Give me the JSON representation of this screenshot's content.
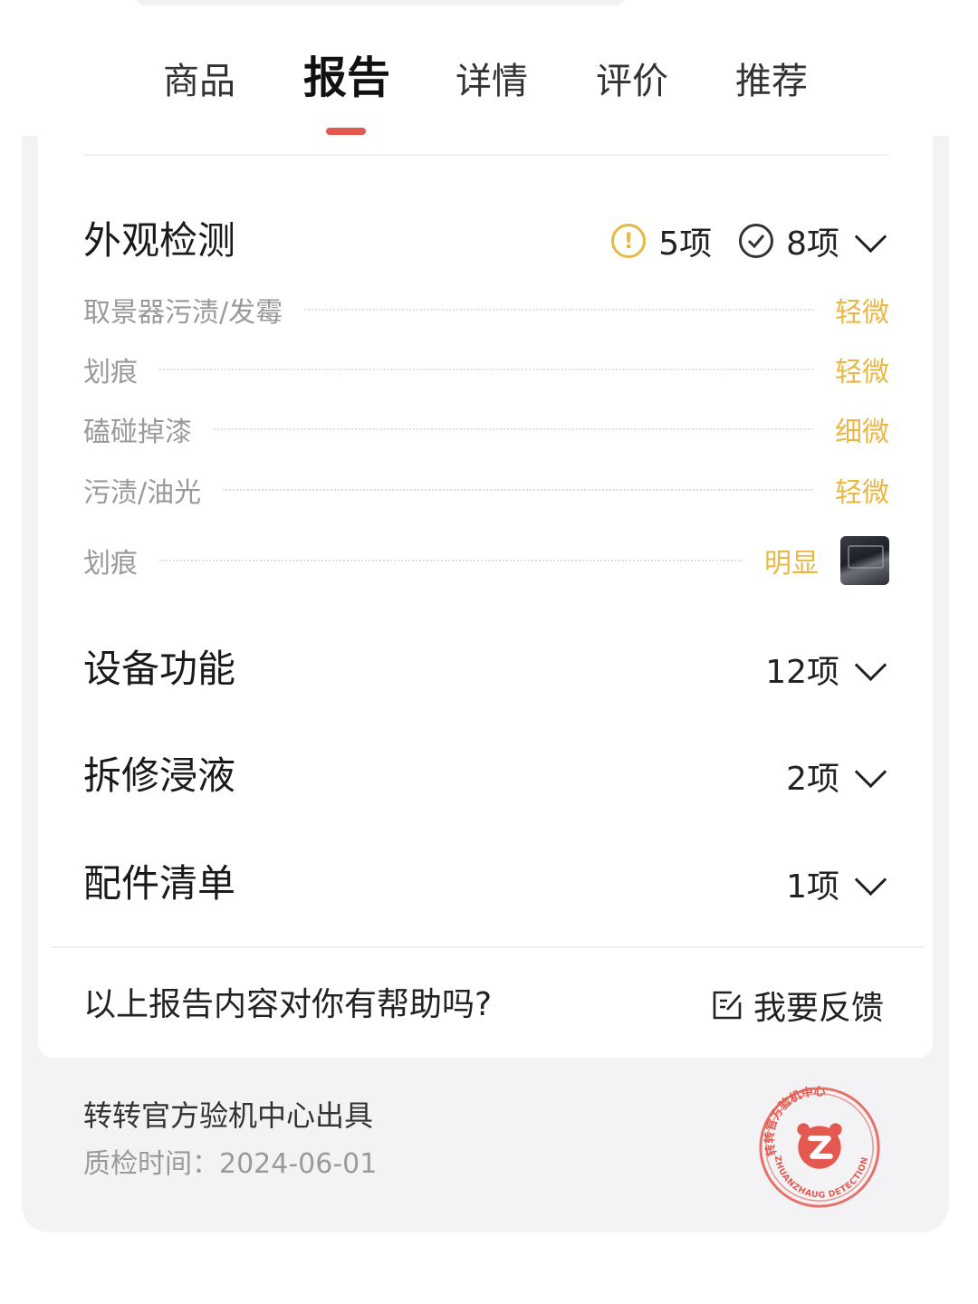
{
  "tabs": [
    {
      "label": "商品",
      "active": false
    },
    {
      "label": "报告",
      "active": true
    },
    {
      "label": "详情",
      "active": false
    },
    {
      "label": "评价",
      "active": false
    },
    {
      "label": "推荐",
      "active": false
    }
  ],
  "colors": {
    "accent": "#e4584f",
    "warning": "#e9b743",
    "muted": "#9a9a9a"
  },
  "sections": {
    "appearance": {
      "title": "外观检测",
      "warning_count": "5项",
      "pass_count": "8项",
      "icons": [
        "warning-circle-icon",
        "check-circle-icon",
        "chevron-down-icon"
      ],
      "items": [
        {
          "label": "取景器污渍/发霉",
          "value": "轻微"
        },
        {
          "label": "划痕",
          "value": "轻微"
        },
        {
          "label": "磕碰掉漆",
          "value": "细微"
        },
        {
          "label": "污渍/油光",
          "value": "轻微"
        },
        {
          "label": "划痕",
          "value": "明显",
          "has_photo": true
        }
      ]
    },
    "function": {
      "title": "设备功能",
      "count": "12项"
    },
    "repair": {
      "title": "拆修浸液",
      "count": "2项"
    },
    "accessories": {
      "title": "配件清单",
      "count": "1项"
    }
  },
  "feedback": {
    "question": "以上报告内容对你有帮助吗?",
    "button_label": "我要反馈",
    "icon": "edit-icon"
  },
  "footer": {
    "issuer": "转转官方验机中心出具",
    "date_label": "质检时间：",
    "date_value": "2024-06-01",
    "seal_text_top": "转转官方验机中心",
    "seal_text_bottom": "ZHUANZHAUG DETECTION"
  }
}
